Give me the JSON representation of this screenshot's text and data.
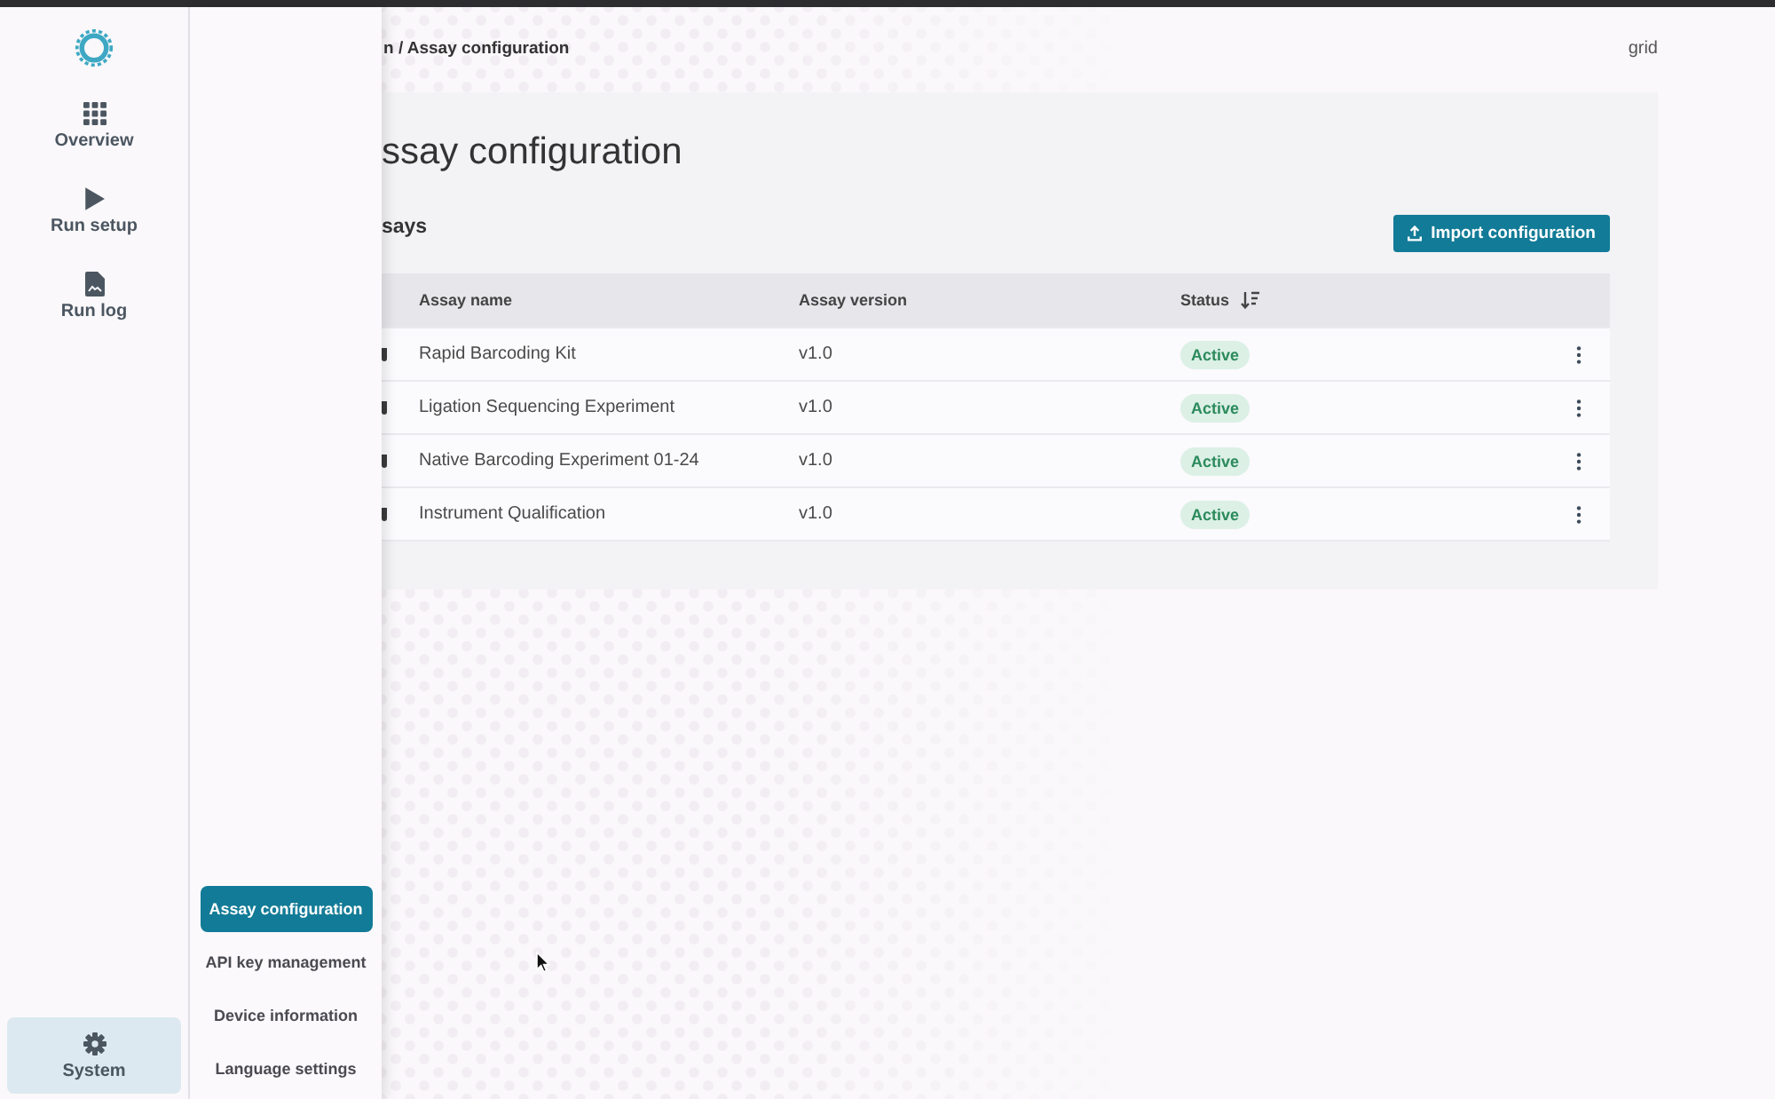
{
  "nav_rail": {
    "items": [
      {
        "label": "Overview",
        "selected": false
      },
      {
        "label": "Run setup",
        "selected": false
      },
      {
        "label": "Run log",
        "selected": false
      }
    ],
    "footer_items": [
      {
        "label": "System",
        "selected": true
      }
    ]
  },
  "submenu": {
    "items": [
      {
        "label": "Assay configuration",
        "selected": true
      },
      {
        "label": "API key management",
        "selected": false
      },
      {
        "label": "Device information",
        "selected": false
      },
      {
        "label": "Language settings",
        "selected": false
      }
    ]
  },
  "header": {
    "breadcrumb": "n / Assay configuration",
    "right_text": "grid"
  },
  "page": {
    "title": "ssay configuration",
    "section_title": "says",
    "import_button": "Import configuration"
  },
  "table": {
    "columns": [
      {
        "label": "Assay name",
        "sorted": false
      },
      {
        "label": "Assay version",
        "sorted": false
      },
      {
        "label": "Status",
        "sorted": true
      }
    ],
    "rows": [
      {
        "name": "Rapid Barcoding Kit",
        "version": "v1.0",
        "status": "Active"
      },
      {
        "name": "Ligation Sequencing Experiment",
        "version": "v1.0",
        "status": "Active"
      },
      {
        "name": "Native Barcoding Experiment 01-24",
        "version": "v1.0",
        "status": "Active"
      },
      {
        "name": "Instrument Qualification",
        "version": "v1.0",
        "status": "Active"
      }
    ]
  }
}
